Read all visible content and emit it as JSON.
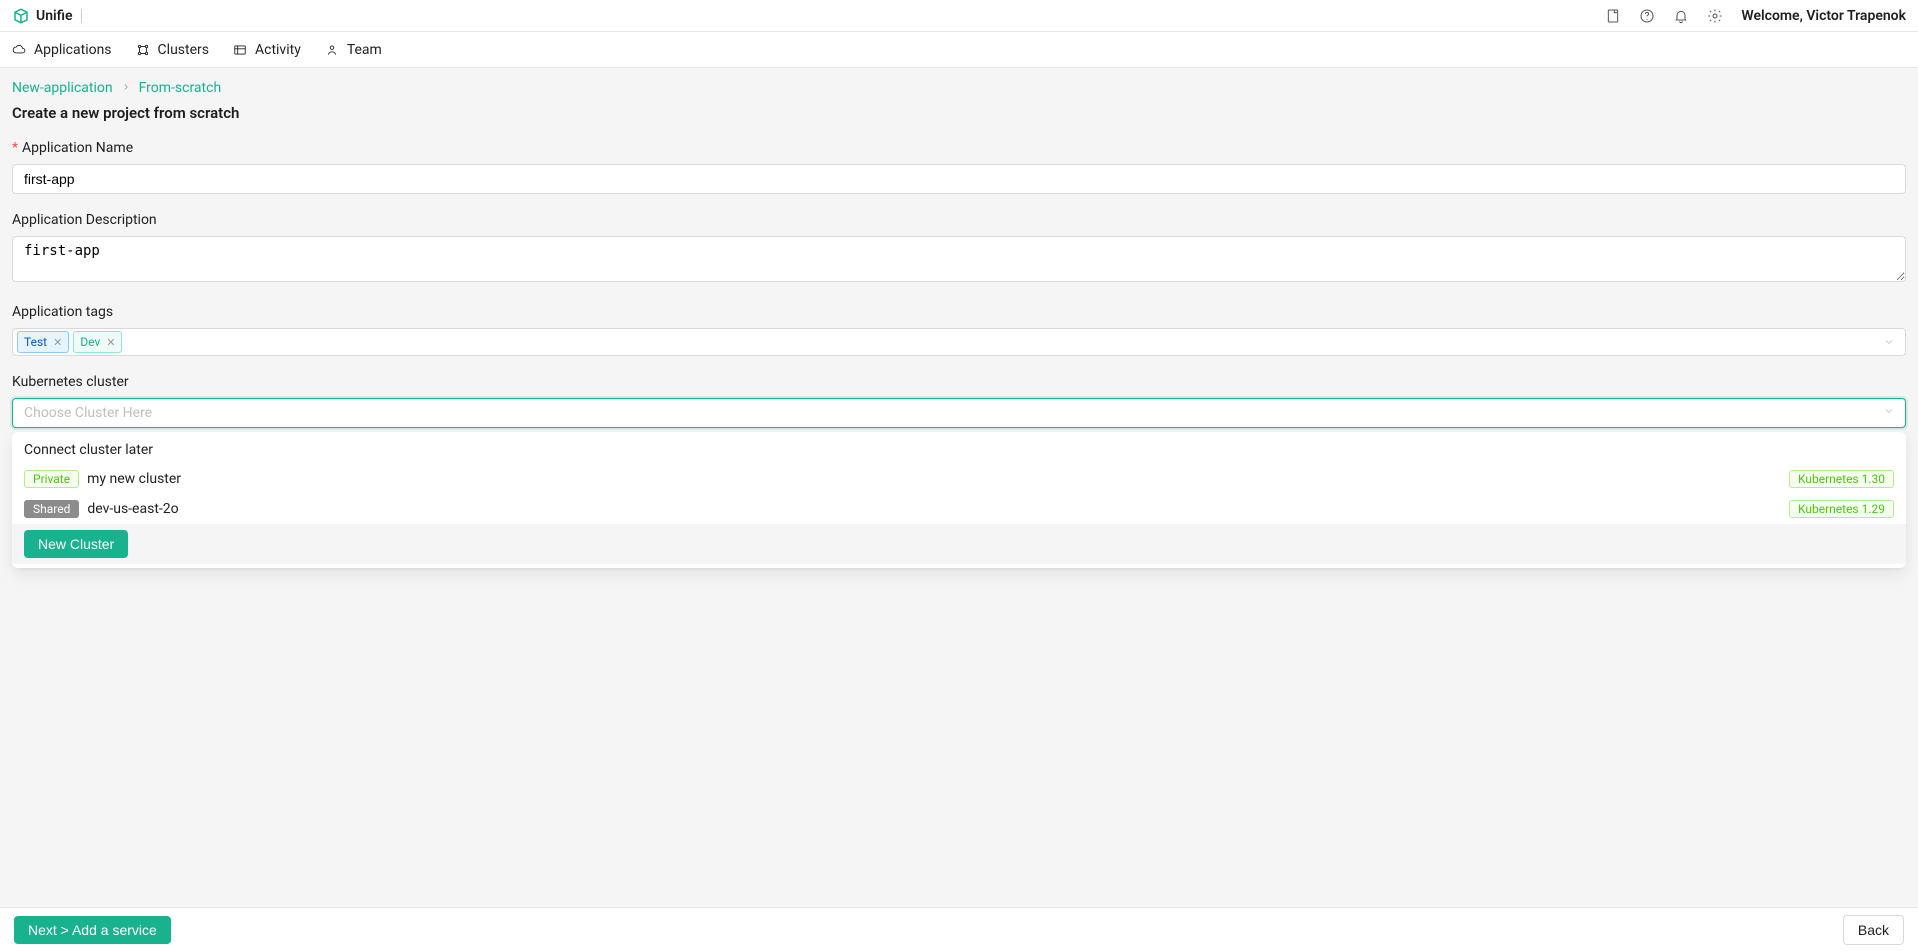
{
  "header": {
    "brand": "Unifie",
    "welcome": "Welcome, Victor Trapenok"
  },
  "nav": {
    "items": [
      {
        "label": "Applications"
      },
      {
        "label": "Clusters"
      },
      {
        "label": "Activity"
      },
      {
        "label": "Team"
      }
    ]
  },
  "breadcrumb": {
    "a": "New-application",
    "b": "From-scratch"
  },
  "page": {
    "title": "Create a new project from scratch"
  },
  "form": {
    "name_label": "Application Name",
    "name_value": "first-app",
    "desc_label": "Application Description",
    "desc_value": "first-app",
    "tags_label": "Application tags",
    "tags": [
      {
        "text": "Test",
        "color": "blue"
      },
      {
        "text": "Dev",
        "color": "green"
      }
    ],
    "cluster_label": "Kubernetes cluster",
    "cluster_placeholder": "Choose Cluster Here"
  },
  "dropdown": {
    "connect_later": "Connect cluster later",
    "items": [
      {
        "type": "Private",
        "name": "my new cluster",
        "k8s": "Kubernetes 1.30"
      },
      {
        "type": "Shared",
        "name": "dev-us-east-2o",
        "k8s": "Kubernetes 1.29"
      }
    ],
    "new_cluster": "New Cluster"
  },
  "footer": {
    "next": "Next > Add a service",
    "back": "Back"
  }
}
